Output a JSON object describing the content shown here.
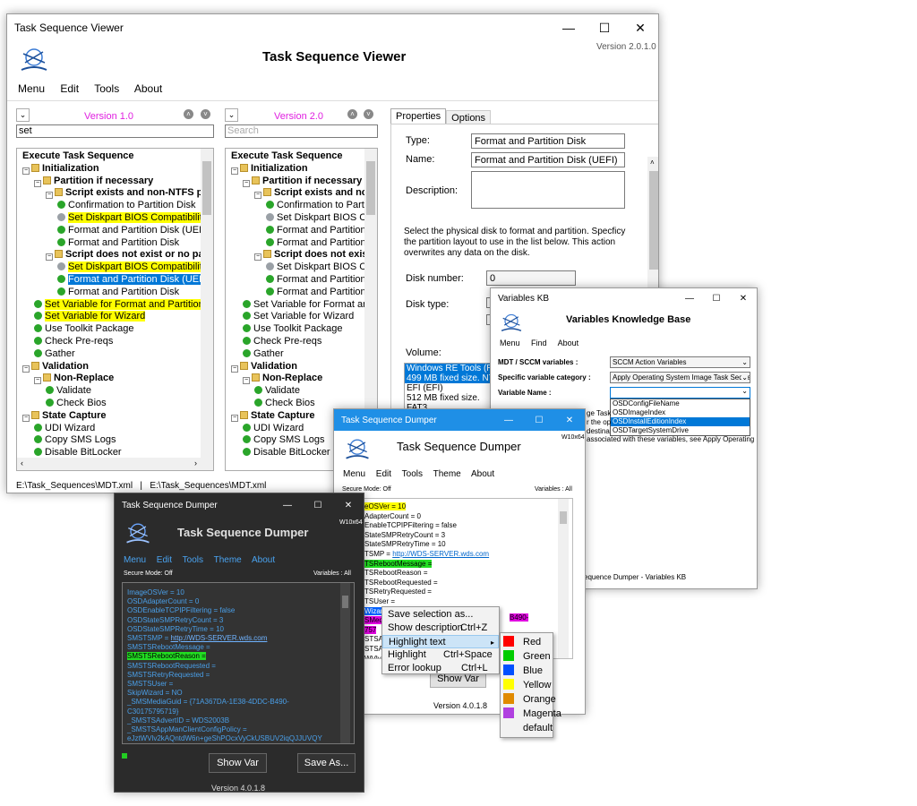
{
  "viewer": {
    "title": "Task Sequence Viewer",
    "app_title": "Task Sequence Viewer",
    "version": "Version 2.0.1.0",
    "menu": [
      "Menu",
      "Edit",
      "Tools",
      "About"
    ],
    "left": {
      "version_label": "Version 1.0",
      "search_value": "set",
      "tree": [
        {
          "text": "Execute Task Sequence",
          "indent": 0,
          "icon": "none",
          "bold": true,
          "hl": ""
        },
        {
          "text": "Initialization",
          "indent": 0,
          "icon": "folder",
          "bold": true,
          "hl": ""
        },
        {
          "text": "Partition if necessary",
          "indent": 1,
          "icon": "folder",
          "bold": true,
          "hl": ""
        },
        {
          "text": "Script exists and non-NTFS partit",
          "indent": 2,
          "icon": "folder",
          "bold": true,
          "hl": ""
        },
        {
          "text": "Confirmation to Partition Disk",
          "indent": 3,
          "icon": "ok",
          "bold": false,
          "hl": ""
        },
        {
          "text": "Set Diskpart BIOS Compatibility",
          "indent": 3,
          "icon": "mod",
          "bold": false,
          "hl": "yellow"
        },
        {
          "text": "Format and Partition Disk (UEF",
          "indent": 3,
          "icon": "ok",
          "bold": false,
          "hl": ""
        },
        {
          "text": "Format and Partition Disk",
          "indent": 3,
          "icon": "ok",
          "bold": false,
          "hl": ""
        },
        {
          "text": "Script does not exist or no partiti",
          "indent": 2,
          "icon": "folder",
          "bold": true,
          "hl": ""
        },
        {
          "text": "Set Diskpart BIOS Compatibility",
          "indent": 3,
          "icon": "mod",
          "bold": false,
          "hl": "yellow"
        },
        {
          "text": "Format and Partition Disk (UEFI",
          "indent": 3,
          "icon": "ok",
          "bold": false,
          "hl": "sel"
        },
        {
          "text": "Format and Partition Disk",
          "indent": 3,
          "icon": "ok",
          "bold": false,
          "hl": ""
        },
        {
          "text": "Set Variable for Format and Partition I",
          "indent": 1,
          "icon": "ok",
          "bold": false,
          "hl": "yellow"
        },
        {
          "text": "Set Variable for Wizard",
          "indent": 1,
          "icon": "ok",
          "bold": false,
          "hl": "yellow"
        },
        {
          "text": "Use Toolkit Package",
          "indent": 1,
          "icon": "ok",
          "bold": false,
          "hl": ""
        },
        {
          "text": "Check Pre-reqs",
          "indent": 1,
          "icon": "ok",
          "bold": false,
          "hl": ""
        },
        {
          "text": "Gather",
          "indent": 1,
          "icon": "ok",
          "bold": false,
          "hl": ""
        },
        {
          "text": "Validation",
          "indent": 0,
          "icon": "folder",
          "bold": true,
          "hl": ""
        },
        {
          "text": "Non-Replace",
          "indent": 1,
          "icon": "folder",
          "bold": true,
          "hl": ""
        },
        {
          "text": "Validate",
          "indent": 2,
          "icon": "ok",
          "bold": false,
          "hl": ""
        },
        {
          "text": "Check Bios",
          "indent": 2,
          "icon": "ok",
          "bold": false,
          "hl": ""
        },
        {
          "text": "State Capture",
          "indent": 0,
          "icon": "folder",
          "bold": true,
          "hl": ""
        },
        {
          "text": "UDI Wizard",
          "indent": 1,
          "icon": "ok",
          "bold": false,
          "hl": ""
        },
        {
          "text": "Copy SMS Logs",
          "indent": 1,
          "icon": "ok",
          "bold": false,
          "hl": ""
        },
        {
          "text": "Disable BitLocker",
          "indent": 1,
          "icon": "ok",
          "bold": false,
          "hl": ""
        }
      ]
    },
    "right": {
      "version_label": "Version 2.0",
      "search_placeholder": "Search",
      "tree": [
        {
          "text": "Execute Task Sequence",
          "indent": 0,
          "icon": "none",
          "bold": true,
          "hl": ""
        },
        {
          "text": "Initialization",
          "indent": 0,
          "icon": "folder",
          "bold": true,
          "hl": ""
        },
        {
          "text": "Partition if necessary",
          "indent": 1,
          "icon": "folder",
          "bold": true,
          "hl": ""
        },
        {
          "text": "Script exists and non-N",
          "indent": 2,
          "icon": "folder",
          "bold": true,
          "hl": ""
        },
        {
          "text": "Confirmation to Part",
          "indent": 3,
          "icon": "ok",
          "bold": false,
          "hl": ""
        },
        {
          "text": "Set Diskpart BIOS C",
          "indent": 3,
          "icon": "mod",
          "bold": false,
          "hl": ""
        },
        {
          "text": "Format and Partition",
          "indent": 3,
          "icon": "ok",
          "bold": false,
          "hl": ""
        },
        {
          "text": "Format and Partition",
          "indent": 3,
          "icon": "ok",
          "bold": false,
          "hl": ""
        },
        {
          "text": "Script does not exist o",
          "indent": 2,
          "icon": "folder",
          "bold": true,
          "hl": ""
        },
        {
          "text": "Set Diskpart BIOS C",
          "indent": 3,
          "icon": "mod",
          "bold": false,
          "hl": ""
        },
        {
          "text": "Format and Partition",
          "indent": 3,
          "icon": "ok",
          "bold": false,
          "hl": ""
        },
        {
          "text": "Format and Partition",
          "indent": 3,
          "icon": "ok",
          "bold": false,
          "hl": ""
        },
        {
          "text": "Set Variable for Format an",
          "indent": 1,
          "icon": "ok",
          "bold": false,
          "hl": ""
        },
        {
          "text": "Set Variable for Wizard",
          "indent": 1,
          "icon": "ok",
          "bold": false,
          "hl": ""
        },
        {
          "text": "Use Toolkit Package",
          "indent": 1,
          "icon": "ok",
          "bold": false,
          "hl": ""
        },
        {
          "text": "Check Pre-reqs",
          "indent": 1,
          "icon": "ok",
          "bold": false,
          "hl": ""
        },
        {
          "text": "Gather",
          "indent": 1,
          "icon": "ok",
          "bold": false,
          "hl": ""
        },
        {
          "text": "Validation",
          "indent": 0,
          "icon": "folder",
          "bold": true,
          "hl": ""
        },
        {
          "text": "Non-Replace",
          "indent": 1,
          "icon": "folder",
          "bold": true,
          "hl": ""
        },
        {
          "text": "Validate",
          "indent": 2,
          "icon": "ok",
          "bold": false,
          "hl": ""
        },
        {
          "text": "Check Bios",
          "indent": 2,
          "icon": "ok",
          "bold": false,
          "hl": ""
        },
        {
          "text": "State Capture",
          "indent": 0,
          "icon": "folder",
          "bold": true,
          "hl": ""
        },
        {
          "text": "UDI Wizard",
          "indent": 1,
          "icon": "ok",
          "bold": false,
          "hl": ""
        },
        {
          "text": "Copy SMS Logs",
          "indent": 1,
          "icon": "ok",
          "bold": false,
          "hl": ""
        },
        {
          "text": "Disable BitLocker",
          "indent": 1,
          "icon": "ok",
          "bold": false,
          "hl": ""
        }
      ]
    },
    "props": {
      "tabs": [
        "Properties",
        "Options"
      ],
      "type_label": "Type:",
      "type_value": "Format and Partition Disk",
      "name_label": "Name:",
      "name_value": "Format and Partition Disk (UEFI)",
      "desc_label": "Description:",
      "info": "Select the physical disk to format and partition. Specficy the partition layout to use in the list below. This action overwrites any data on the disk.",
      "disk_number_label": "Disk number:",
      "disk_number_value": "0",
      "disk_type_label": "Disk type:",
      "volume_label": "Volume:",
      "volumes": [
        "Windows RE Tools (RE",
        "499 MB fixed size. NTF",
        "EFI (EFI)",
        "512 MB fixed size. FAT3"
      ]
    },
    "status_left": "E:\\Task_Sequences\\MDT.xml",
    "status_sep": "|",
    "status_right": "E:\\Task_Sequences\\MDT.xml"
  },
  "kb": {
    "title": "Variables KB",
    "app_title": "Variables Knowledge Base",
    "menu": [
      "Menu",
      "Find",
      "About"
    ],
    "mdt_label": "MDT / SCCM variables :",
    "mdt_value": "SCCM Action Variables",
    "cat_label": "Specific variable category :",
    "cat_value": "Apply Operating System Image Task Seque",
    "var_label": "Variable Name :",
    "options": [
      "OSDConfigFileName",
      "OSDImageIndex",
      "OSDInstallEditionIndex",
      "OSDTargetSystemDrive"
    ],
    "desc_frag1": "ge Task",
    "desc_frag2": "r the op",
    "desc_frag3": "destina",
    "desc_frag4": "associated with these variables, see Apply Operating",
    "footer": "equence Dumper - Variables KB"
  },
  "dumper_light": {
    "title": "Task Sequence Dumper",
    "app_title": "Task Sequence Dumper",
    "os_label": "W10x64",
    "menu": [
      "Menu",
      "Edit",
      "Tools",
      "Theme",
      "About"
    ],
    "secure": "Secure Mode: Off",
    "variables": "Variables : All",
    "lines": [
      {
        "text": "eOSVer = 10",
        "hl": "yellow",
        "link": ""
      },
      {
        "text": "AdapterCount = 0",
        "hl": "",
        "link": ""
      },
      {
        "text": "EnableTCPIPFiltering = false",
        "hl": "",
        "link": ""
      },
      {
        "text": "StateSMPRetryCount = 3",
        "hl": "",
        "link": ""
      },
      {
        "text": "StateSMPRetryTime = 10",
        "hl": "",
        "link": ""
      },
      {
        "text": "TSMP = ",
        "hl": "",
        "link": "http://WDS-SERVER.wds.com"
      },
      {
        "text": "TSRebootMessage =",
        "hl": "green",
        "link": ""
      },
      {
        "text": "TSRebootReason =",
        "hl": "",
        "link": ""
      },
      {
        "text": "TSRebootRequested =",
        "hl": "",
        "link": ""
      },
      {
        "text": "TSRetryRequested =",
        "hl": "",
        "link": ""
      },
      {
        "text": "TSUser =",
        "hl": "",
        "link": ""
      },
      {
        "text": "Wizar",
        "hl": "blue",
        "link": ""
      },
      {
        "text": "SMed",
        "hl": "magenta",
        "link": ""
      },
      {
        "text": "757",
        "hl": "magenta",
        "link": ""
      },
      {
        "text": "STSA",
        "hl": "",
        "link": ""
      },
      {
        "text": "STSA",
        "hl": "",
        "link": ""
      },
      {
        "text": "WVlv",
        "hl": "",
        "link": ""
      }
    ],
    "magenta_tail": "B490-",
    "show_var": "Show Var",
    "version": "Version 4.0.1.8"
  },
  "context_menu": {
    "items": [
      {
        "label": "Save selection as...",
        "shortcut": ""
      },
      {
        "label": "Show description",
        "shortcut": "Ctrl+Z"
      },
      {
        "label": "Highlight text",
        "shortcut": ""
      },
      {
        "label": "Highlight",
        "shortcut": "Ctrl+Space"
      },
      {
        "label": "Error lookup",
        "shortcut": "Ctrl+L"
      }
    ],
    "submenu": [
      {
        "label": "Red",
        "color": "#ff0000"
      },
      {
        "label": "Green",
        "color": "#00cc00"
      },
      {
        "label": "Blue",
        "color": "#0050ff"
      },
      {
        "label": "Yellow",
        "color": "#ffff00"
      },
      {
        "label": "Orange",
        "color": "#e08a00"
      },
      {
        "label": "Magenta",
        "color": "#b040e0"
      },
      {
        "label": "default",
        "color": ""
      }
    ]
  },
  "dumper_dark": {
    "title": "Task Sequence Dumper",
    "app_title": "Task Sequence Dumper",
    "os_label": "W10x64",
    "menu": [
      "Menu",
      "Edit",
      "Tools",
      "Theme",
      "About"
    ],
    "secure": "Secure Mode: Off",
    "variables": "Variables : All",
    "lines": [
      {
        "text": "ImageOSVer = 10",
        "hl": "",
        "link": ""
      },
      {
        "text": "OSDAdapterCount = 0",
        "hl": "",
        "link": ""
      },
      {
        "text": "OSDEnableTCPIPFiltering = false",
        "hl": "",
        "link": ""
      },
      {
        "text": "OSDStateSMPRetryCount = 3",
        "hl": "",
        "link": ""
      },
      {
        "text": "OSDStateSMPRetryTime = 10",
        "hl": "",
        "link": ""
      },
      {
        "text": "SMSTSMP = ",
        "hl": "",
        "link": "http://WDS-SERVER.wds.com"
      },
      {
        "text": "SMSTSRebootMessage =",
        "hl": "",
        "link": ""
      },
      {
        "text": "SMSTSRebootReason =",
        "hl": "green",
        "link": ""
      },
      {
        "text": "SMSTSRebootRequested =",
        "hl": "",
        "link": ""
      },
      {
        "text": "SMSTSRetryRequested =",
        "hl": "",
        "link": ""
      },
      {
        "text": "SMSTSUser =",
        "hl": "",
        "link": ""
      },
      {
        "text": "SkipWizard = NO",
        "hl": "",
        "link": ""
      },
      {
        "text": "_SMSMediaGuid = {71A367DA-1E38-4DDC-B490-",
        "hl": "",
        "link": ""
      },
      {
        "text": "C30175795719}",
        "hl": "",
        "link": ""
      },
      {
        "text": "_SMSTSAdvertID = WDS2003B",
        "hl": "",
        "link": ""
      },
      {
        "text": "_SMSTSAppManClientConfigPolicy =",
        "hl": "",
        "link": ""
      },
      {
        "text": "eJztWVlv2kAQntdW6n+geShPOcxVyCkUSBUV2iqQJJUVQY",
        "hl": "",
        "link": ""
      }
    ],
    "show_var": "Show Var",
    "save_as": "Save As...",
    "version": "Version 4.0.1.8"
  },
  "window_controls": {
    "minimize": "—",
    "maximize": "☐",
    "close": "✕"
  }
}
